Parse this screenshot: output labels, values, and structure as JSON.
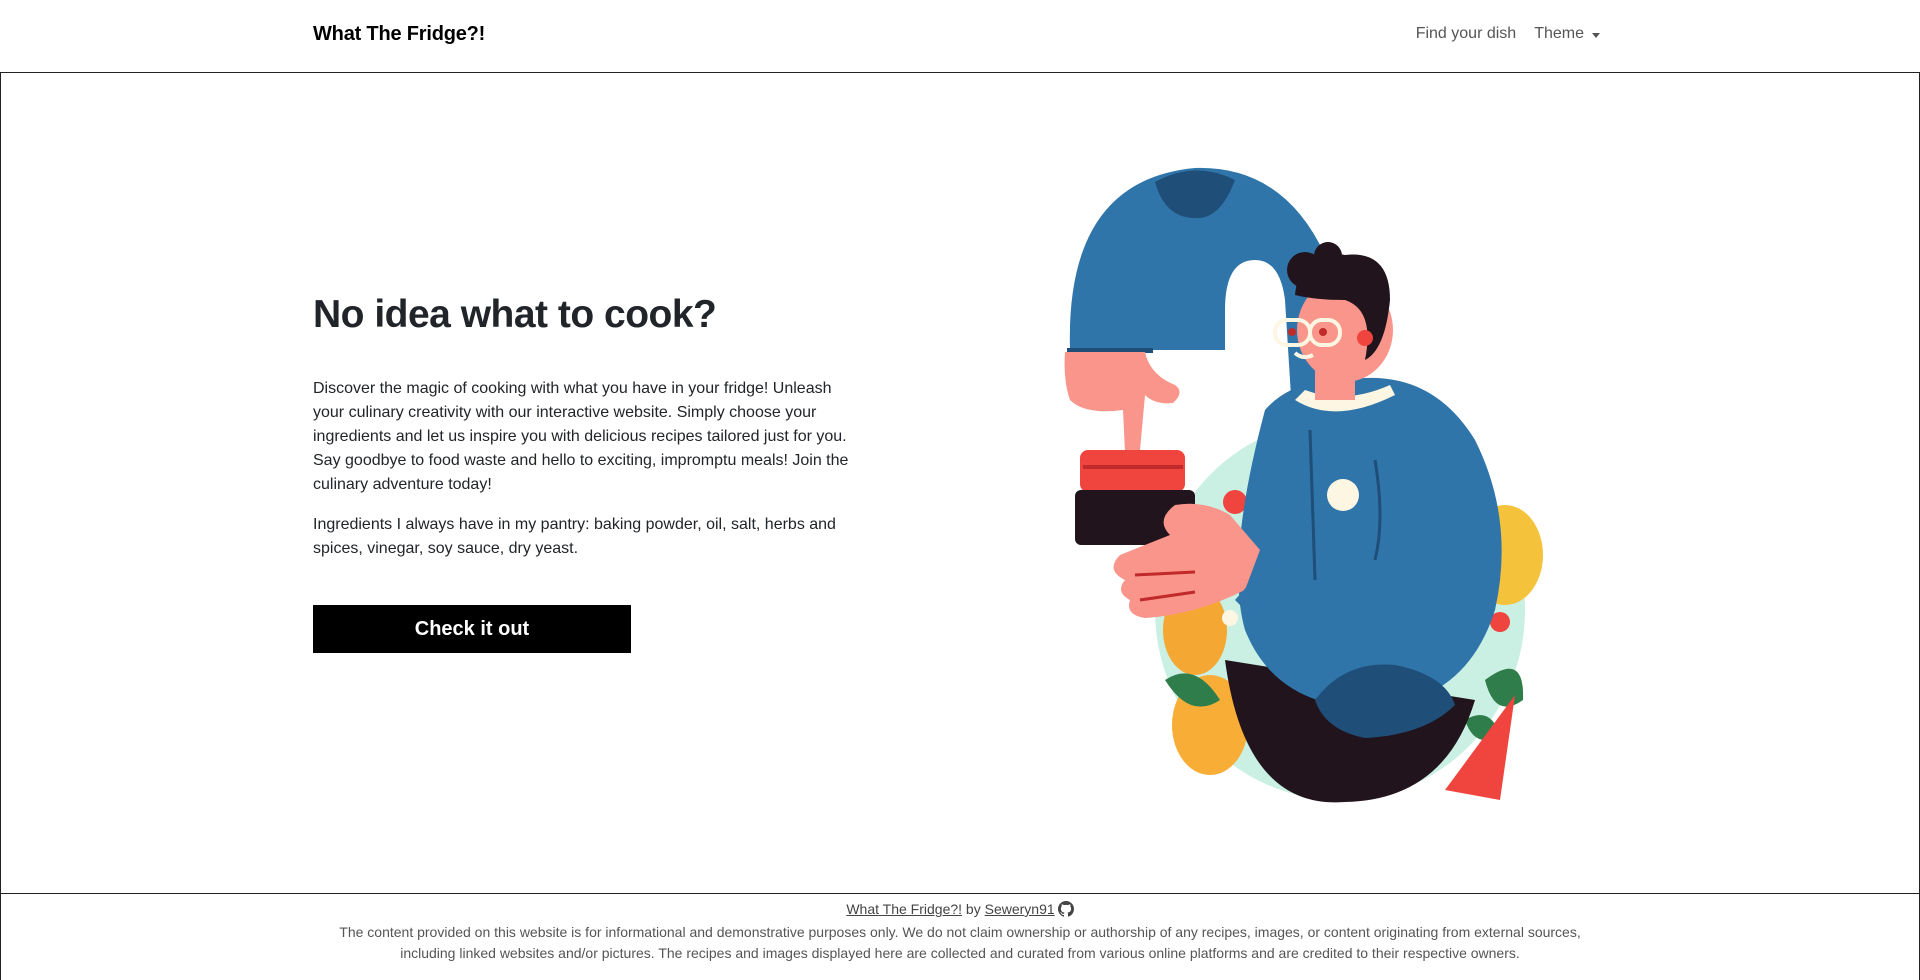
{
  "nav": {
    "brand": "What The Fridge?!",
    "find_label": "Find your dish",
    "theme_label": "Theme"
  },
  "hero": {
    "title": "No idea what to cook?",
    "description": "Discover the magic of cooking with what you have in your fridge! Unleash your culinary creativity with our interactive website. Simply choose your ingredients and let us inspire you with delicious recipes tailored just for you. Say goodbye to food waste and hello to exciting, impromptu meals! Join the culinary adventure today!",
    "pantry": "Ingredients I always have in my pantry: baking powder, oil, salt, herbs and spices, vinegar, soy sauce, dry yeast.",
    "cta_label": "Check it out"
  },
  "footer": {
    "app_link": "What The Fridge?!",
    "by": "by",
    "author_link": "Seweryn91",
    "disclaimer": "The content provided on this website is for informational and demonstrative purposes only. We do not claim ownership or authorship of any recipes, images, or content originating from external sources, including linked websites and/or pictures. The recipes and images displayed here are collected and curated from various online platforms and are credited to their respective owners."
  },
  "icons": {
    "github": "github-icon",
    "dropdown": "chevron-down-icon"
  },
  "colors": {
    "shirt": "#2f75aa",
    "shirt_dark": "#1f4e78",
    "skin": "#f9958a",
    "pants": "#22141c",
    "jar_lid": "#f0443e",
    "mint": "#c9f0e3",
    "lemon": "#f5c33b",
    "leaf": "#2e7d4b"
  }
}
